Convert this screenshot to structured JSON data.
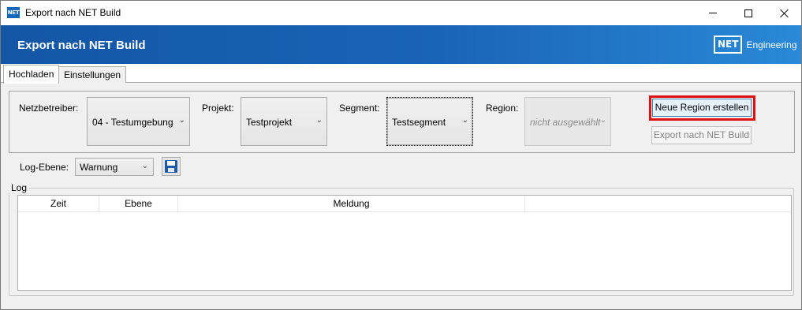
{
  "window": {
    "title": "Export nach NET Build",
    "app_icon_text": "NET",
    "minimize_icon": "minimize-icon",
    "maximize_icon": "maximize-icon",
    "close_icon": "close-icon"
  },
  "banner": {
    "title": "Export nach NET Build",
    "logo_box": "NET",
    "logo_text": "Engineering"
  },
  "tabs": [
    {
      "label": "Hochladen",
      "active": true
    },
    {
      "label": "Einstellungen",
      "active": false
    }
  ],
  "settings": {
    "netzbetreiber_label": "Netzbetreiber:",
    "netzbetreiber_value": "04 - Testumgebung",
    "projekt_label": "Projekt:",
    "projekt_value": "Testprojekt",
    "segment_label": "Segment:",
    "segment_value": "Testsegment",
    "region_label": "Region:",
    "region_value": "nicht ausgewählt",
    "new_region_button": "Neue Region erstellen",
    "export_button": "Export nach NET Build"
  },
  "log_level": {
    "label": "Log-Ebene:",
    "value": "Warnung",
    "save_icon": "save-icon"
  },
  "log": {
    "legend": "Log",
    "columns": [
      "Zeit",
      "Ebene",
      "Meldung",
      ""
    ],
    "rows": []
  },
  "colors": {
    "banner_start": "#1356a6",
    "banner_end": "#2a89d8",
    "highlight": "#e01010"
  }
}
